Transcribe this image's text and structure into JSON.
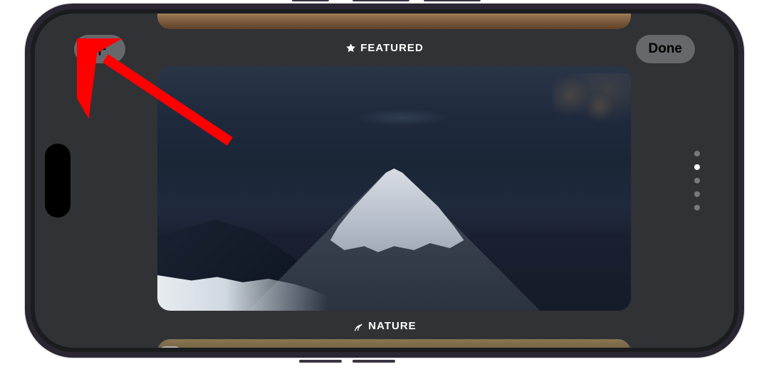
{
  "header": {
    "add_label": "+",
    "done_label": "Done"
  },
  "categories": {
    "previous": {
      "label": "FEATURED",
      "icon": "star-icon"
    },
    "current": {
      "label": "NATURE",
      "icon": "leaf-icon"
    }
  },
  "pagination": {
    "total": 5,
    "active_index": 1
  },
  "annotation": {
    "color": "#ff0000",
    "target": "add-button"
  }
}
